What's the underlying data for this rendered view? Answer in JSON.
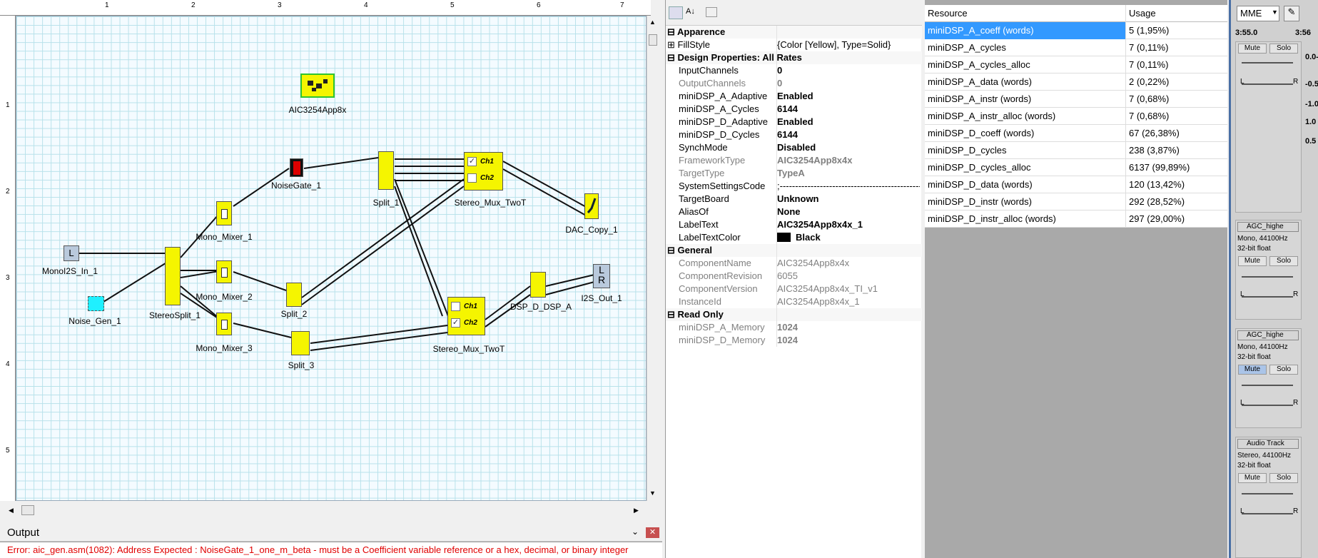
{
  "designer": {
    "ruler_top": [
      "1",
      "2",
      "3",
      "4",
      "5",
      "6",
      "7"
    ],
    "ruler_left": [
      "1",
      "2",
      "3",
      "4",
      "5"
    ],
    "components": {
      "app": "AIC3254App8x",
      "noisegate": "NoiseGate_1",
      "split1": "Split_1",
      "mux1": "Stereo_Mux_TwoT",
      "dac": "DAC_Copy_1",
      "mono_in": "MonoI2S_In_1",
      "mono_in_glyph": "L",
      "mixer1": "Mono_Mixer_1",
      "noise_gen": "Noise_Gen_1",
      "stereo_split": "StereoSplit_1",
      "mixer2": "Mono_Mixer_2",
      "split2": "Split_2",
      "mixer3": "Mono_Mixer_3",
      "split3": "Split_3",
      "mux2": "Stereo_Mux_TwoT",
      "dsp": "DSP_D_DSP_A",
      "i2s_out": "I2S_Out_1",
      "i2s_out_glyph_l": "L",
      "i2s_out_glyph_r": "R",
      "ch1": "Ch1",
      "ch2": "Ch2"
    }
  },
  "output": {
    "title": "Output",
    "error": "Error: aic_gen.asm(1082): Address Expected : NoiseGate_1_one_m_beta - must be a Coefficient variable reference or a hex, decimal, or binary integer"
  },
  "properties": {
    "categories": {
      "appearance": "Apparence",
      "design": "Design Properties: All Rates",
      "general": "General",
      "readonly": "Read Only"
    },
    "rows": {
      "fillstyle_n": "FillStyle",
      "fillstyle_v": "{Color [Yellow], Type=Solid}",
      "inch_n": "InputChannels",
      "inch_v": "0",
      "outch_n": "OutputChannels",
      "outch_v": "0",
      "a_adapt_n": "miniDSP_A_Adaptive",
      "a_adapt_v": "Enabled",
      "a_cyc_n": "miniDSP_A_Cycles",
      "a_cyc_v": "6144",
      "d_adapt_n": "miniDSP_D_Adaptive",
      "d_adapt_v": "Enabled",
      "d_cyc_n": "miniDSP_D_Cycles",
      "d_cyc_v": "6144",
      "synch_n": "SynchMode",
      "synch_v": "Disabled",
      "fw_n": "FrameworkType",
      "fw_v": "AIC3254App8x4x",
      "tt_n": "TargetType",
      "tt_v": "TypeA",
      "ssc_n": "SystemSettingsCode",
      "ssc_v": ";-----------------------------------------------",
      "tb_n": "TargetBoard",
      "tb_v": "Unknown",
      "alias_n": "AliasOf",
      "alias_v": "None",
      "lt_n": "LabelText",
      "lt_v": "AIC3254App8x4x_1",
      "ltc_n": "LabelTextColor",
      "ltc_v": "Black",
      "cn_n": "ComponentName",
      "cn_v": "AIC3254App8x4x",
      "cr_n": "ComponentRevision",
      "cr_v": "6055",
      "cv_n": "ComponentVersion",
      "cv_v": "AIC3254App8x4x_TI_v1",
      "iid_n": "InstanceId",
      "iid_v": "AIC3254App8x4x_1",
      "am_n": "miniDSP_A_Memory",
      "am_v": "1024",
      "dm_n": "miniDSP_D_Memory",
      "dm_v": "1024"
    }
  },
  "resources": {
    "headers": [
      "Resource",
      "Usage"
    ],
    "rows": [
      {
        "name": "miniDSP_A_coeff (words)",
        "usage": "5  (1,95%)"
      },
      {
        "name": "miniDSP_A_cycles",
        "usage": "7  (0,11%)"
      },
      {
        "name": "miniDSP_A_cycles_alloc",
        "usage": "7  (0,11%)"
      },
      {
        "name": "miniDSP_A_data (words)",
        "usage": "2  (0,22%)"
      },
      {
        "name": "miniDSP_A_instr (words)",
        "usage": "7  (0,68%)"
      },
      {
        "name": "miniDSP_A_instr_alloc (words)",
        "usage": "7  (0,68%)"
      },
      {
        "name": "miniDSP_D_coeff (words)",
        "usage": "67  (26,38%)"
      },
      {
        "name": "miniDSP_D_cycles",
        "usage": "238  (3,87%)"
      },
      {
        "name": "miniDSP_D_cycles_alloc",
        "usage": "6137  (99,89%)"
      },
      {
        "name": "miniDSP_D_data (words)",
        "usage": "120  (13,42%)"
      },
      {
        "name": "miniDSP_D_instr (words)",
        "usage": "292  (28,52%)"
      },
      {
        "name": "miniDSP_D_instr_alloc (words)",
        "usage": "297  (29,00%)"
      }
    ]
  },
  "audacity": {
    "host": "MME",
    "time1": "3:55.0",
    "time2": "3:56",
    "mute": "Mute",
    "solo": "Solo",
    "lr_l": "L",
    "lr_r": "R",
    "scale": [
      "0.0-",
      "-0.5",
      "-1.0",
      "1.0",
      "0.5"
    ],
    "tracks": [
      {
        "name": "AGC_highe",
        "info1": "Mono, 44100Hz",
        "info2": "32-bit float"
      },
      {
        "name": "AGC_highe",
        "info1": "Mono, 44100Hz",
        "info2": "32-bit float"
      },
      {
        "name": "Audio Track",
        "info1": "Stereo, 44100Hz",
        "info2": "32-bit float"
      }
    ]
  }
}
